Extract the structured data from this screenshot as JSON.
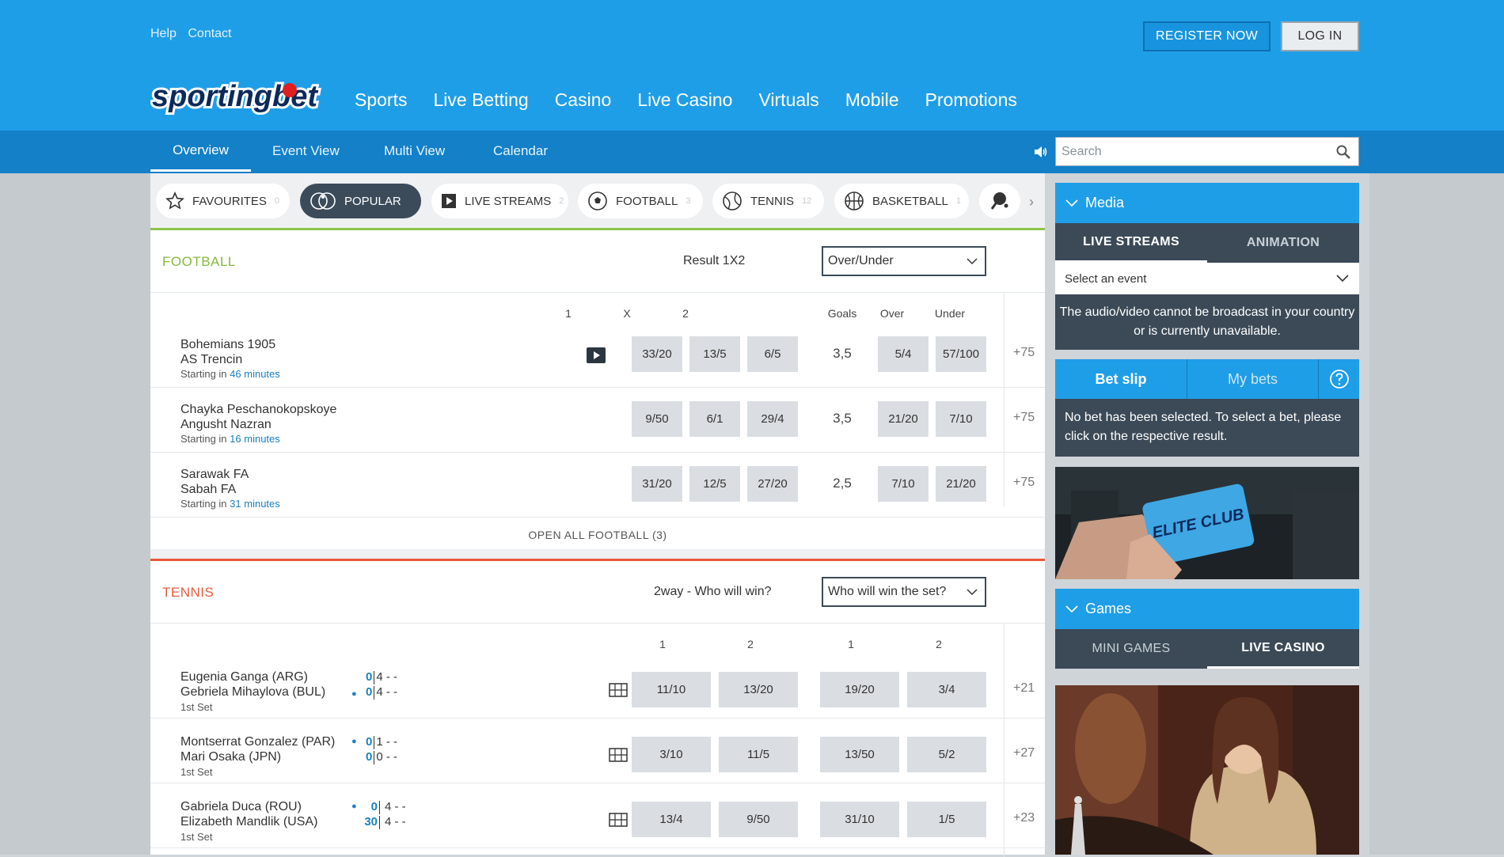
{
  "header": {
    "links": [
      "Help",
      "Contact"
    ],
    "register_label": "REGISTER NOW",
    "login_label": "LOG IN",
    "logo_text": "sportingbet",
    "nav": [
      "Sports",
      "Live Betting",
      "Casino",
      "Live Casino",
      "Virtuals",
      "Mobile",
      "Promotions"
    ]
  },
  "subnav": {
    "tabs": [
      "Overview",
      "Event View",
      "Multi View",
      "Calendar"
    ],
    "active": "Overview",
    "search_placeholder": "Search"
  },
  "filters": [
    {
      "label": "FAVOURITES",
      "count": "0",
      "icon": "star-icon"
    },
    {
      "label": "POPULAR",
      "count": "",
      "icon": "popular-icon"
    },
    {
      "label": "LIVE STREAMS",
      "count": "2",
      "icon": "play-icon"
    },
    {
      "label": "FOOTBALL",
      "count": "3",
      "icon": "football-icon"
    },
    {
      "label": "TENNIS",
      "count": "12",
      "icon": "tennis-icon"
    },
    {
      "label": "BASKETBALL",
      "count": "1",
      "icon": "basketball-icon"
    }
  ],
  "football": {
    "title": "FOOTBALL",
    "market": "Result 1X2",
    "dropdown": "Over/Under",
    "cols": [
      "1",
      "X",
      "2",
      "Goals",
      "Over",
      "Under"
    ],
    "matches": [
      {
        "home": "Bohemians 1905",
        "away": "AS Trencin",
        "starting": "Starting in",
        "minutes": "46 minutes",
        "odds": [
          "33/20",
          "13/5",
          "6/5"
        ],
        "goals": "3,5",
        "ou": [
          "5/4",
          "57/100"
        ],
        "more": "+75"
      },
      {
        "home": "Chayka Peschanokopskoye",
        "away": "Angusht Nazran",
        "starting": "Starting in",
        "minutes": "16 minutes",
        "odds": [
          "9/50",
          "6/1",
          "29/4"
        ],
        "goals": "3,5",
        "ou": [
          "21/20",
          "7/10"
        ],
        "more": "+75"
      },
      {
        "home": "Sarawak FA",
        "away": "Sabah FA",
        "starting": "Starting in",
        "minutes": "31 minutes",
        "odds": [
          "31/20",
          "12/5",
          "27/20"
        ],
        "goals": "2,5",
        "ou": [
          "7/10",
          "21/20"
        ],
        "more": "+75"
      }
    ],
    "open_all": "OPEN ALL FOOTBALL (3)"
  },
  "tennis": {
    "title": "TENNIS",
    "market": "2way - Who will win?",
    "dropdown": "Who will win the set?",
    "cols": [
      "1",
      "2",
      "1",
      "2"
    ],
    "matches": [
      {
        "p1": "Eugenia Ganga (ARG)",
        "p2": "Gebriela Mihaylova (BUL)",
        "s1": "0",
        "s1b": "4 - -",
        "s2": "0",
        "s2b": "4 - -",
        "serve": 2,
        "set": "1st Set",
        "odds": [
          "11/10",
          "13/20",
          "19/20",
          "3/4"
        ],
        "more": "+21"
      },
      {
        "p1": "Montserrat Gonzalez (PAR)",
        "p2": "Mari Osaka (JPN)",
        "s1": "0",
        "s1b": "1 - -",
        "s2": "0",
        "s2b": "0 - -",
        "serve": 1,
        "set": "1st Set",
        "odds": [
          "3/10",
          "11/5",
          "13/50",
          "5/2"
        ],
        "more": "+27"
      },
      {
        "p1": "Gabriela Duca (ROU)",
        "p2": "Elizabeth Mandlik (USA)",
        "s1": "0",
        "s1b": "4 - -",
        "s2": "30",
        "s2b": "4 - -",
        "serve": 1,
        "set": "1st Set",
        "odds": [
          "13/4",
          "9/50",
          "31/10",
          "1/5"
        ],
        "more": "+23"
      }
    ]
  },
  "media": {
    "title": "Media",
    "tabs": [
      "LIVE STREAMS",
      "ANIMATION"
    ],
    "select": "Select an event",
    "message": "The audio/video cannot be broadcast in your country or is currently unavailable."
  },
  "betslip": {
    "tabs": [
      "Bet slip",
      "My bets"
    ],
    "message": "No bet has been selected. To select a bet, please click on the respective result."
  },
  "elite_text": "ELITE CLUB",
  "games": {
    "title": "Games",
    "tabs": [
      "MINI GAMES",
      "LIVE CASINO"
    ]
  },
  "colors": {
    "header": "#1f9ee8",
    "subnav": "#1380c8",
    "dark": "#3c4a57",
    "football": "#8cc34a",
    "tennis": "#e8573a"
  }
}
